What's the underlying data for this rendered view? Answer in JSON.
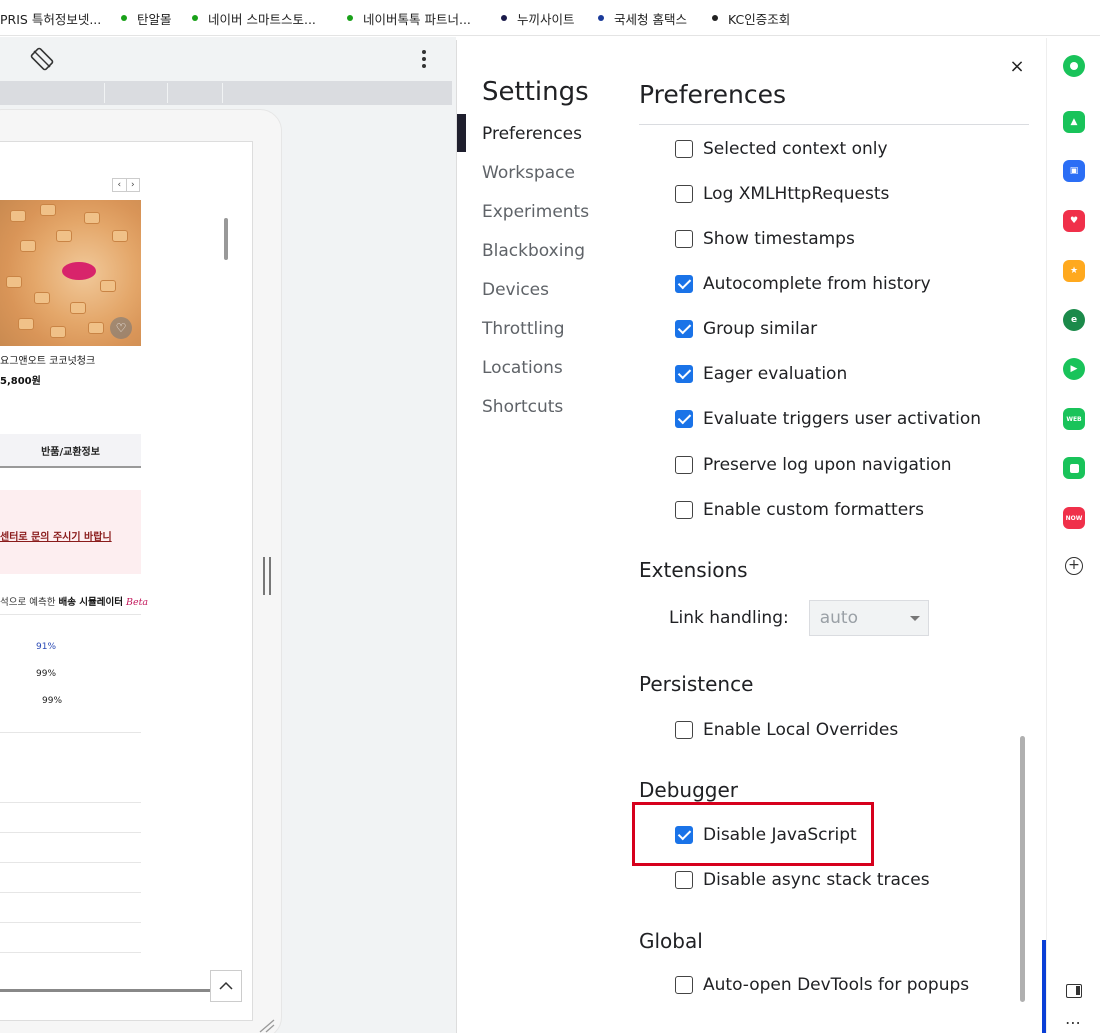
{
  "bookmarks": [
    {
      "label": "PRIS 특허정보넷...",
      "dot_color": ""
    },
    {
      "label": "탄알몰",
      "dot_color": "#19a119"
    },
    {
      "label": "네이버 스마트스토...",
      "dot_color": "#19a119"
    },
    {
      "label": "네이버톡톡 파트너...",
      "dot_color": "#19a119"
    },
    {
      "label": "누끼사이트",
      "dot_color": "#1a1a4a"
    },
    {
      "label": "국세청 홈택스",
      "dot_color": "#1a3a9a"
    },
    {
      "label": "KC인증조회",
      "dot_color": "#222222"
    }
  ],
  "preview": {
    "pager_prev": "‹",
    "pager_next": "›",
    "product_name": "요그앤오트 코코넛청크",
    "product_price": "5,800원",
    "tab_return": "반품/교환정보",
    "notice": "센터로 문의 주시기 바랍니",
    "shipping_prefix": "석으로 예측한 ",
    "shipping_bold": "배송 시뮬레이터",
    "shipping_beta": "Beta",
    "percentages": [
      "91%",
      "99%",
      "99%"
    ]
  },
  "settings": {
    "title": "Settings",
    "close_label": "×",
    "nav": [
      "Preferences",
      "Workspace",
      "Experiments",
      "Blackboxing",
      "Devices",
      "Throttling",
      "Locations",
      "Shortcuts"
    ],
    "active_nav": "Preferences",
    "preferences_title": "Preferences",
    "console_options": [
      {
        "label": "Selected context only",
        "checked": false
      },
      {
        "label": "Log XMLHttpRequests",
        "checked": false
      },
      {
        "label": "Show timestamps",
        "checked": false
      },
      {
        "label": "Autocomplete from history",
        "checked": true
      },
      {
        "label": "Group similar",
        "checked": true
      },
      {
        "label": "Eager evaluation",
        "checked": true
      },
      {
        "label": "Evaluate triggers user activation",
        "checked": true
      },
      {
        "label": "Preserve log upon navigation",
        "checked": false
      },
      {
        "label": "Enable custom formatters",
        "checked": false
      }
    ],
    "extensions": {
      "title": "Extensions",
      "link_handling_label": "Link handling:",
      "link_handling_value": "auto"
    },
    "persistence": {
      "title": "Persistence",
      "options": [
        {
          "label": "Enable Local Overrides",
          "checked": false
        }
      ]
    },
    "debugger": {
      "title": "Debugger",
      "options": [
        {
          "label": "Disable JavaScript",
          "checked": true
        },
        {
          "label": "Disable async stack traces",
          "checked": false
        }
      ]
    },
    "global": {
      "title": "Global",
      "options": [
        {
          "label": "Auto-open DevTools for popups",
          "checked": false
        }
      ]
    },
    "checkbox_color": "#1a73e8",
    "highlight_color": "#d6001c"
  },
  "sidebar_icons": [
    {
      "name": "circle-app-icon",
      "color": "#19c35a",
      "glyph": "●"
    },
    {
      "name": "bell-icon",
      "color": "#19c35a",
      "glyph": "♪"
    },
    {
      "name": "briefcase-icon",
      "color": "#2b6ef5",
      "glyph": "▣"
    },
    {
      "name": "pocket-icon",
      "color": "#f0304a",
      "glyph": "♥"
    },
    {
      "name": "star-icon",
      "color": "#ffa91e",
      "glyph": "★"
    },
    {
      "name": "edge-icon",
      "color": "#1b8a4a",
      "glyph": "e"
    },
    {
      "name": "play-icon",
      "color": "#19c35a",
      "glyph": "▶"
    },
    {
      "name": "webtoon-icon",
      "color": "#19c35a",
      "glyph": "W"
    },
    {
      "name": "square-app-icon",
      "color": "#19c35a",
      "glyph": "■"
    },
    {
      "name": "now-icon",
      "color": "#f0304a",
      "glyph": "NOW"
    }
  ],
  "sidebar_plus": "+",
  "sidebar_more": "⋯"
}
